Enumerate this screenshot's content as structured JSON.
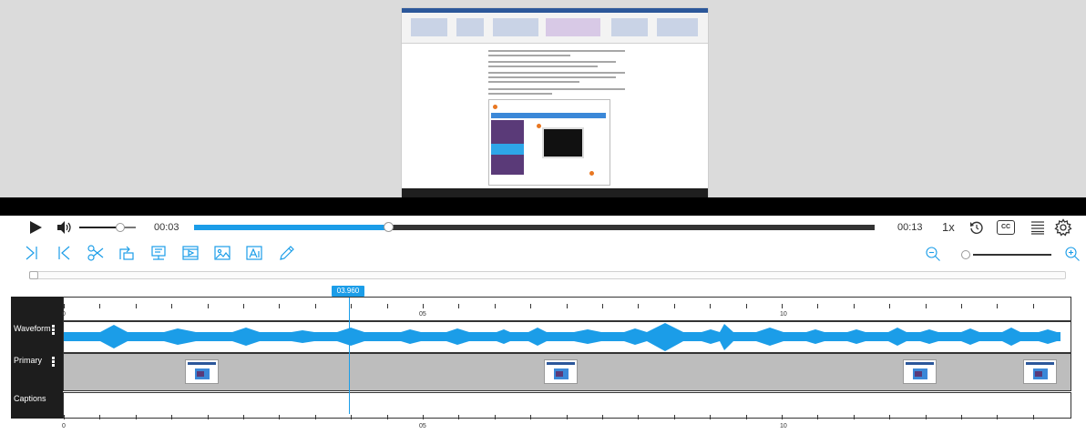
{
  "player": {
    "current_time": "00:03",
    "duration": "00:13",
    "speed": "1x",
    "progress_fraction": 0.287,
    "volume_fraction": 0.7,
    "cc_label": "CC"
  },
  "icons": {
    "play": "play-icon",
    "volume": "volume-icon",
    "replay": "replay-icon",
    "cc": "closed-captions-icon",
    "menu": "list-menu-icon",
    "settings": "gear-icon"
  },
  "toolbar": {
    "tools": [
      "mark-in-icon",
      "mark-out-icon",
      "scissors-icon",
      "insert-icon",
      "presentation-icon",
      "video-insert-icon",
      "image-insert-icon",
      "text-insert-icon",
      "pencil-icon"
    ],
    "zoom_out": "zoom-out-icon",
    "zoom_in": "zoom-in-icon"
  },
  "timeline": {
    "playhead": "03.960",
    "ruler_labels": [
      "0",
      "05",
      "10"
    ],
    "tracks": {
      "waveform": "Waveform",
      "primary": "Primary",
      "captions": "Captions"
    }
  },
  "colors": {
    "accent": "#1b9de8",
    "track_label_bg": "#1d1d1d"
  }
}
